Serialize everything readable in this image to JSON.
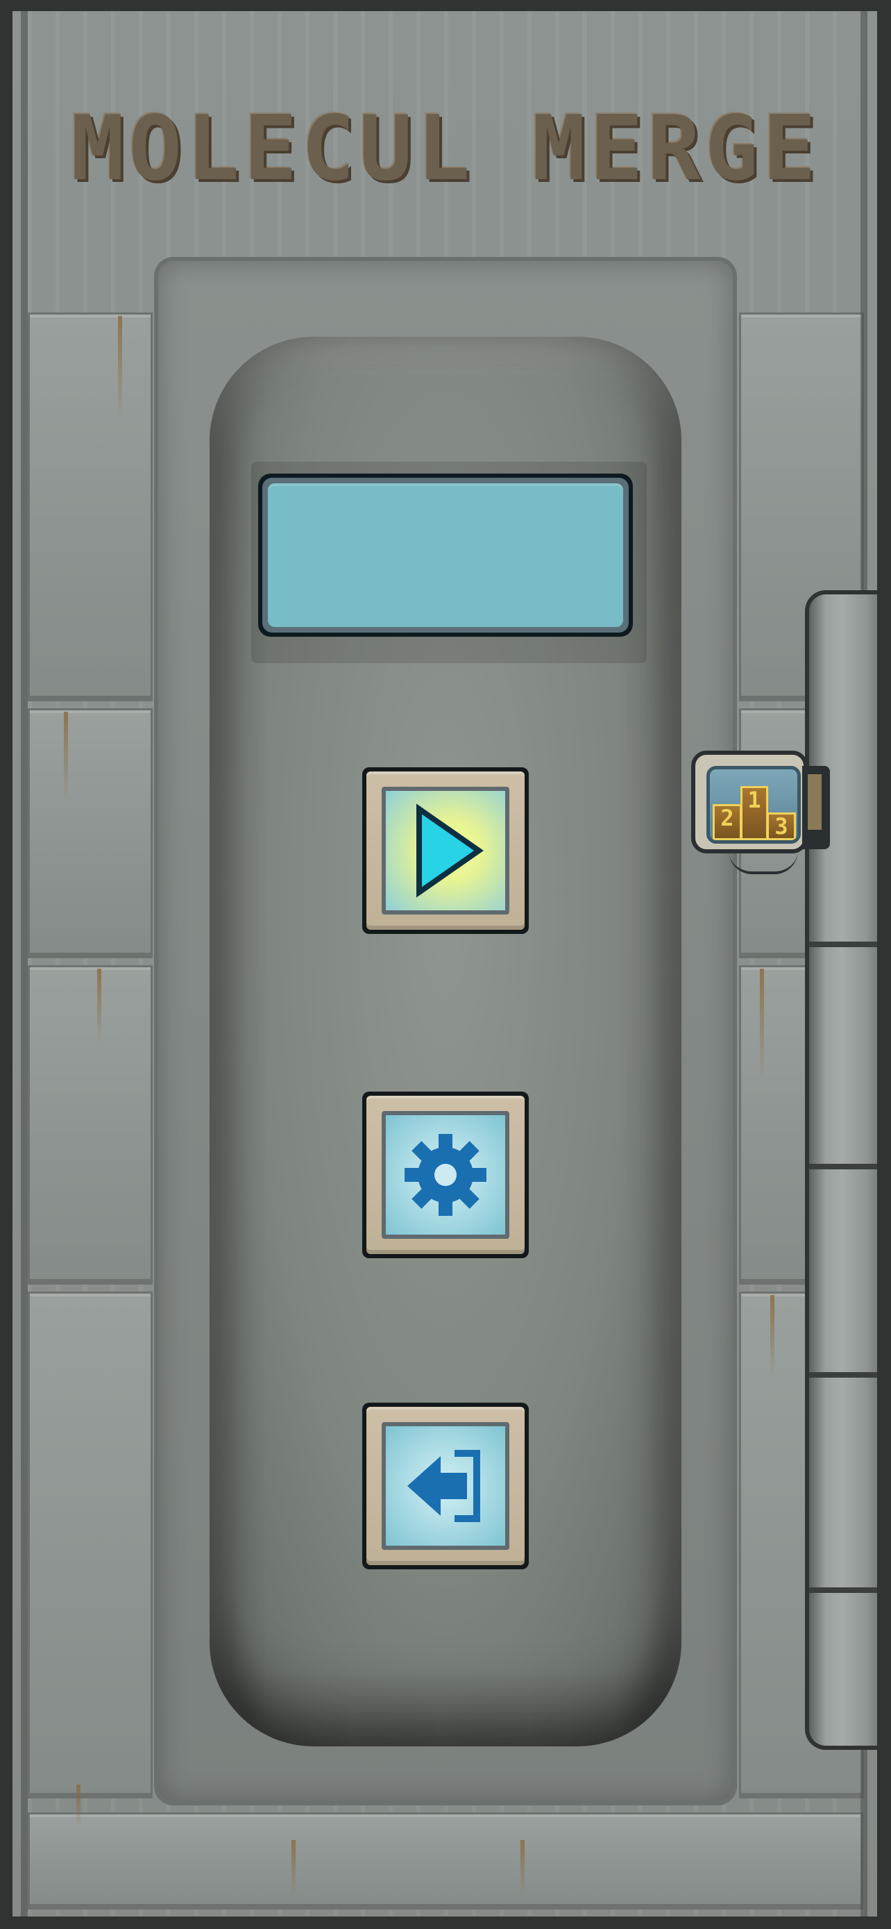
{
  "game": {
    "title": "MOLECUL MERGE"
  },
  "display": {
    "text": ""
  },
  "menu": {
    "buttons": [
      {
        "id": "play",
        "icon": "play-icon"
      },
      {
        "id": "settings",
        "icon": "gear-icon"
      },
      {
        "id": "exit",
        "icon": "exit-arrow-icon"
      }
    ]
  },
  "leaderboard": {
    "icon": "podium-icon",
    "places": [
      "1",
      "2",
      "3"
    ]
  },
  "colors": {
    "title": "#6b5f4e",
    "display_glass": "#77bcc6",
    "button_frame": "#cdbfa6",
    "play_triangle": "#29d3e6",
    "icon_blue": "#1a6fb0",
    "podium_gold": "#f0d25a"
  }
}
